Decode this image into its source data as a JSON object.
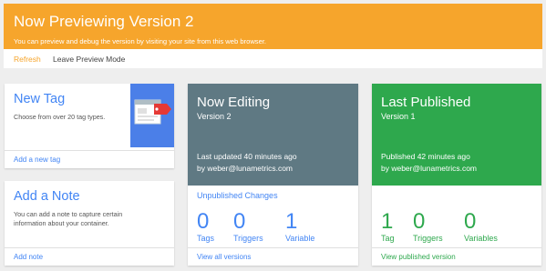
{
  "banner": {
    "title": "Now Previewing Version 2",
    "subtitle": "You can preview and debug the version by visiting your site from this web browser.",
    "refresh_label": "Refresh",
    "leave_label": "Leave Preview Mode"
  },
  "new_tag": {
    "title": "New Tag",
    "description": "Choose from over 20 tag types.",
    "link": "Add a new tag"
  },
  "add_note": {
    "title": "Add a Note",
    "description": "You can add a note to capture certain information about your container.",
    "link": "Add note"
  },
  "now_editing": {
    "title": "Now Editing",
    "version": "Version 2",
    "updated": "Last updated 40 minutes ago",
    "by": "by weber@lunametrics.com",
    "unpublished_label": "Unpublished Changes",
    "stats": [
      {
        "value": "0",
        "label": "Tags"
      },
      {
        "value": "0",
        "label": "Triggers"
      },
      {
        "value": "1",
        "label": "Variable"
      }
    ],
    "link": "View all versions"
  },
  "last_published": {
    "title": "Last Published",
    "version": "Version 1",
    "published": "Published 42 minutes ago",
    "by": "by weber@lunametrics.com",
    "stats": [
      {
        "value": "1",
        "label": "Tag"
      },
      {
        "value": "0",
        "label": "Triggers"
      },
      {
        "value": "0",
        "label": "Variables"
      }
    ],
    "link": "View published version"
  },
  "colors": {
    "banner": "#f6a52c",
    "accent_blue": "#4285f4",
    "editing_header": "#5f7983",
    "published_green": "#2ea84d"
  },
  "icons": {
    "new_tag_graphic": "browser-tag-icon"
  }
}
